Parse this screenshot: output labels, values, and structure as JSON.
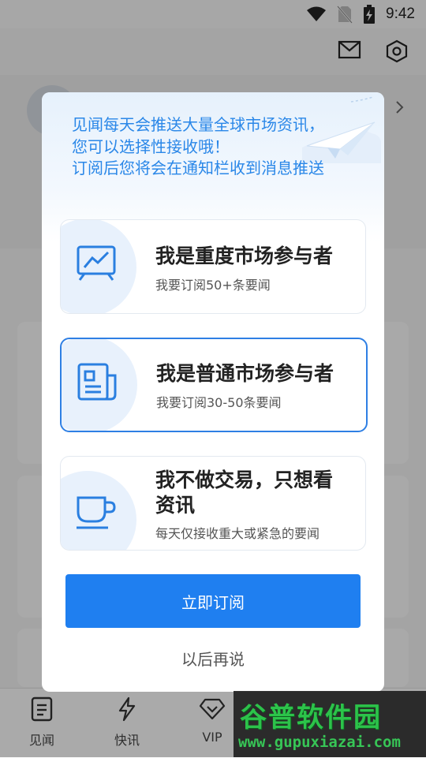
{
  "status_bar": {
    "time": "9:42",
    "icons": [
      "wifi-icon",
      "no-sim-icon",
      "battery-charging-icon"
    ]
  },
  "header_actions": {
    "icons": [
      "mail-icon",
      "settings-icon"
    ]
  },
  "bottom_nav": {
    "items": [
      {
        "label": "见闻",
        "icon": "document-icon"
      },
      {
        "label": "快讯",
        "icon": "lightning-icon"
      },
      {
        "label": "VIP",
        "icon": "diamond-icon"
      }
    ]
  },
  "dialog": {
    "intro_lines": [
      "见闻每天会推送大量全球市场资讯，",
      "您可以选择性接收哦！",
      "订阅后您将会在通知栏收到消息推送"
    ],
    "options": [
      {
        "title": "我是重度市场参与者",
        "subtitle": "我要订阅50+条要闻",
        "icon": "chart-monitor-icon",
        "selected": false
      },
      {
        "title": "我是普通市场参与者",
        "subtitle": "我要订阅30-50条要闻",
        "icon": "newspaper-icon",
        "selected": true
      },
      {
        "title_line1": "我不做交易，只想看",
        "title_line2": "资讯",
        "subtitle": "每天仅接收重大或紧急的要闻",
        "icon": "coffee-cup-icon",
        "selected": false
      }
    ],
    "primary_button": "立即订阅",
    "secondary_button": "以后再说"
  },
  "watermark": {
    "name": "谷普软件园",
    "url": "www.gupuxiazai.com"
  },
  "colors": {
    "accent": "#1f7ff0",
    "header_text": "#2a87e8",
    "option_bubble": "#e8f1fc"
  }
}
